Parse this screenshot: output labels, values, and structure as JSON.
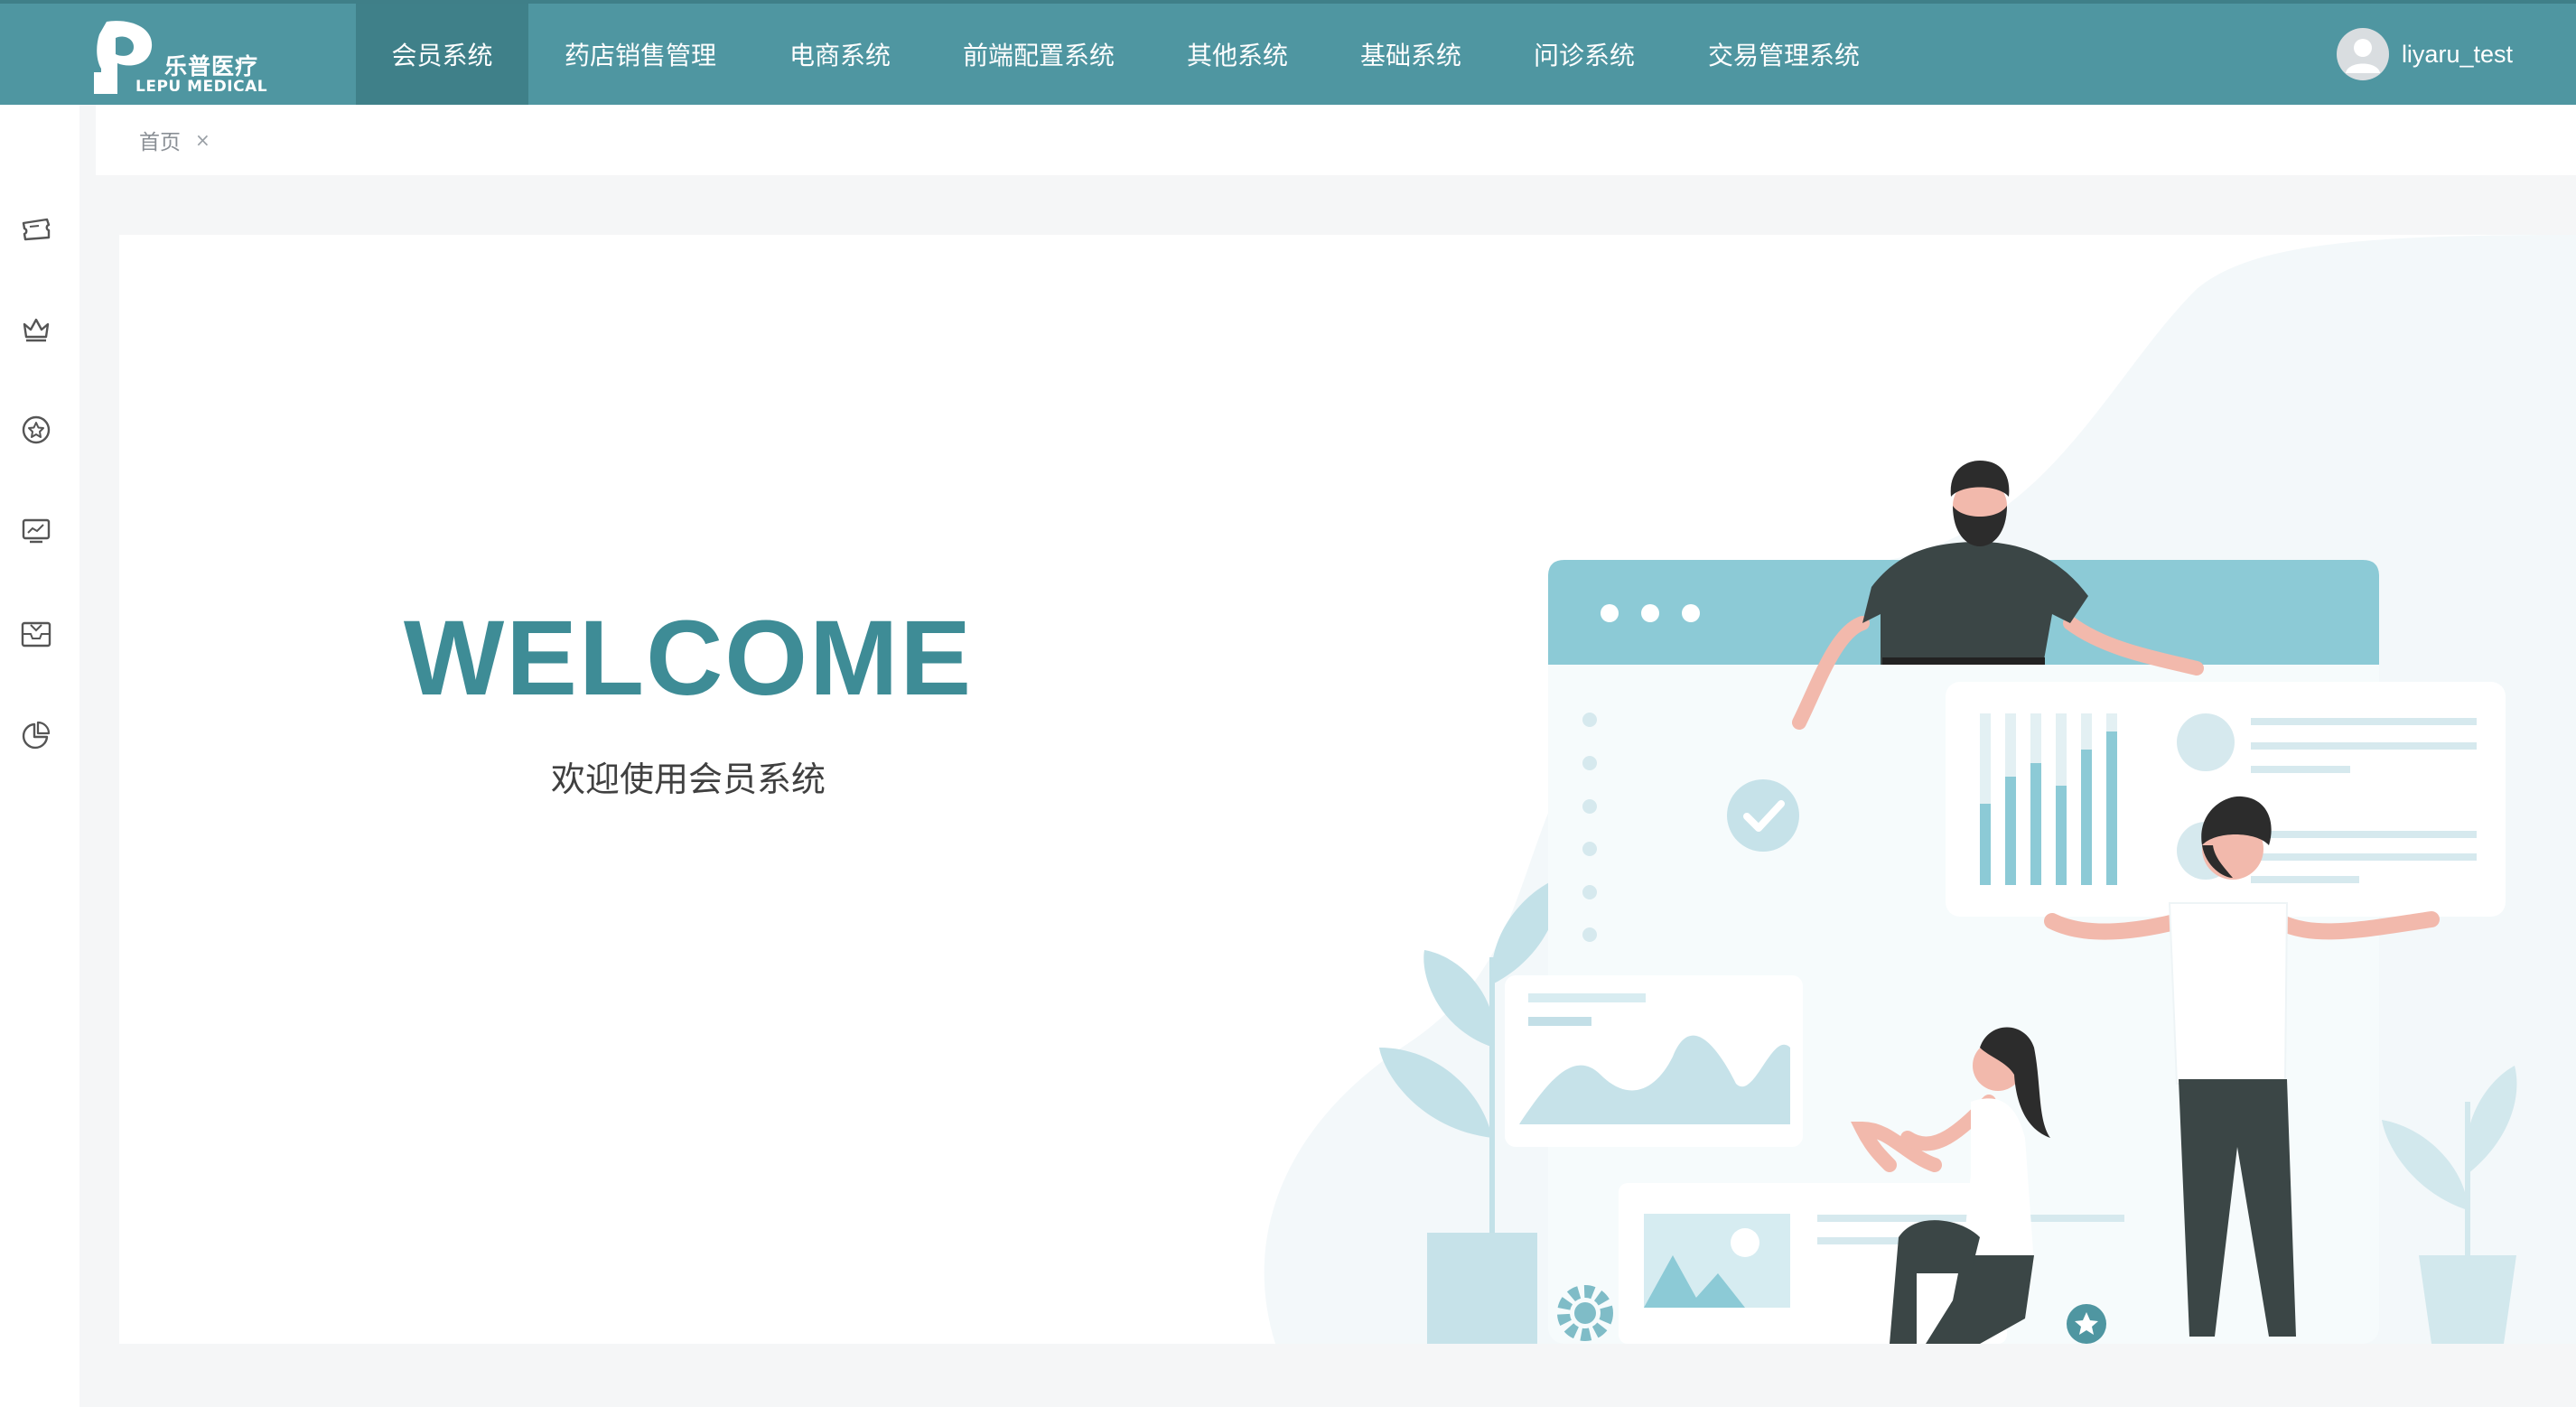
{
  "brand": {
    "name_cn": "乐普医疗",
    "name_en": "LEPU MEDICAL"
  },
  "nav": {
    "items": [
      {
        "label": "会员系统",
        "active": true
      },
      {
        "label": "药店销售管理",
        "active": false
      },
      {
        "label": "电商系统",
        "active": false
      },
      {
        "label": "前端配置系统",
        "active": false
      },
      {
        "label": "其他系统",
        "active": false
      },
      {
        "label": "基础系统",
        "active": false
      },
      {
        "label": "问诊系统",
        "active": false
      },
      {
        "label": "交易管理系统",
        "active": false
      }
    ]
  },
  "user": {
    "name": "liyaru_test"
  },
  "sidebar": {
    "icons": [
      "ticket-icon",
      "crown-icon",
      "star-badge-icon",
      "chart-monitor-icon",
      "inbox-icon",
      "pie-chart-icon"
    ]
  },
  "tabs": {
    "items": [
      {
        "label": "首页",
        "close": "×"
      }
    ]
  },
  "main": {
    "title": "WELCOME",
    "subtitle": "欢迎使用会员系统"
  },
  "colors": {
    "primary": "#4f96a1",
    "primary_dark": "#3f8089",
    "title": "#3e8c96",
    "light_teal": "#a9d5df",
    "dark_figure": "#3b4646"
  }
}
